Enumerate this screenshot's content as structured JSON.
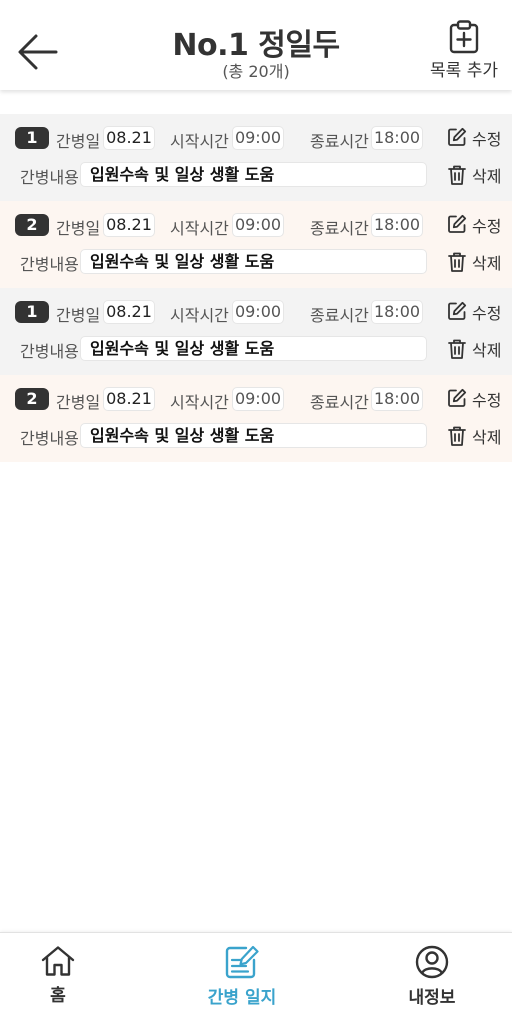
{
  "header": {
    "title": "No.1 정일두",
    "subtitle": "(총 20개)",
    "add_list_label": "목록 추가"
  },
  "labels": {
    "care_date": "간병일",
    "start_time": "시작시간",
    "end_time": "종료시간",
    "care_content": "간병내용",
    "edit": "수정",
    "delete": "삭제"
  },
  "records": [
    {
      "no": "1",
      "date": "08.21",
      "start": "09:00",
      "end": "18:00",
      "content": "입원수속 및 일상 생활 도움"
    },
    {
      "no": "2",
      "date": "08.21",
      "start": "09:00",
      "end": "18:00",
      "content": "입원수속 및 일상 생활 도움"
    },
    {
      "no": "1",
      "date": "08.21",
      "start": "09:00",
      "end": "18:00",
      "content": "입원수속 및 일상 생활 도움"
    },
    {
      "no": "2",
      "date": "08.21",
      "start": "09:00",
      "end": "18:00",
      "content": "입원수속 및 일상 생활 도움"
    }
  ],
  "nav": {
    "home": "홈",
    "care_journal": "간병 일지",
    "my_info": "내정보"
  },
  "colors": {
    "accent": "#3aa3cc",
    "badge": "#333333",
    "row_gray": "#f3f3f3",
    "row_cream": "#fdf6f1"
  }
}
